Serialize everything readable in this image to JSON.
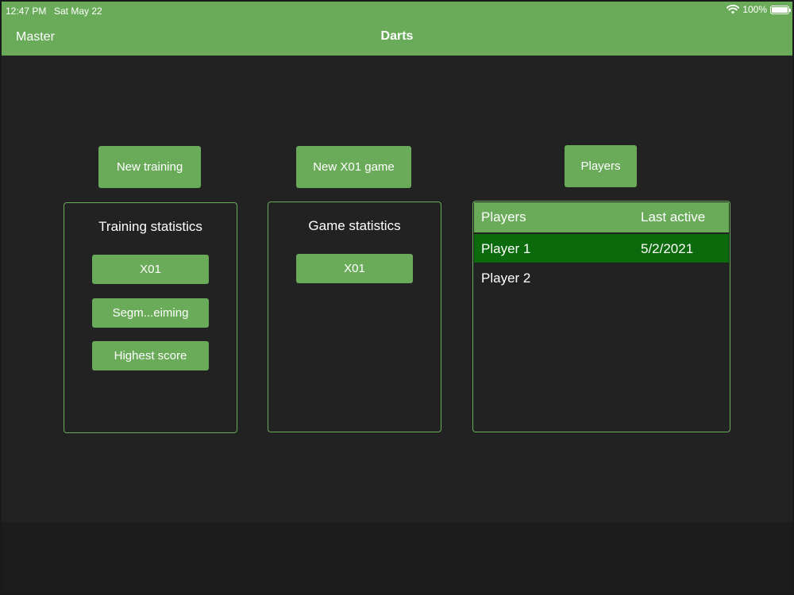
{
  "status_bar": {
    "time": "12:47 PM",
    "date": "Sat May 22",
    "battery": "100%"
  },
  "nav": {
    "back_label": "Master",
    "title": "Darts"
  },
  "actions": {
    "new_training": "New training",
    "new_x01_game": "New X01 game",
    "players": "Players"
  },
  "training_stats": {
    "title": "Training statistics",
    "buttons": [
      "X01",
      "Segm...eiming",
      "Highest score"
    ]
  },
  "game_stats": {
    "title": "Game statistics",
    "buttons": [
      "X01"
    ]
  },
  "players_table": {
    "headers": [
      "Players",
      "Last active"
    ],
    "rows": [
      {
        "name": "Player 1",
        "last_active": "5/2/2021",
        "selected": true
      },
      {
        "name": "Player 2",
        "last_active": "",
        "selected": false
      }
    ]
  },
  "colors": {
    "accent": "#6aab5a",
    "selected_row": "#0b6a0b",
    "background": "#222222"
  }
}
